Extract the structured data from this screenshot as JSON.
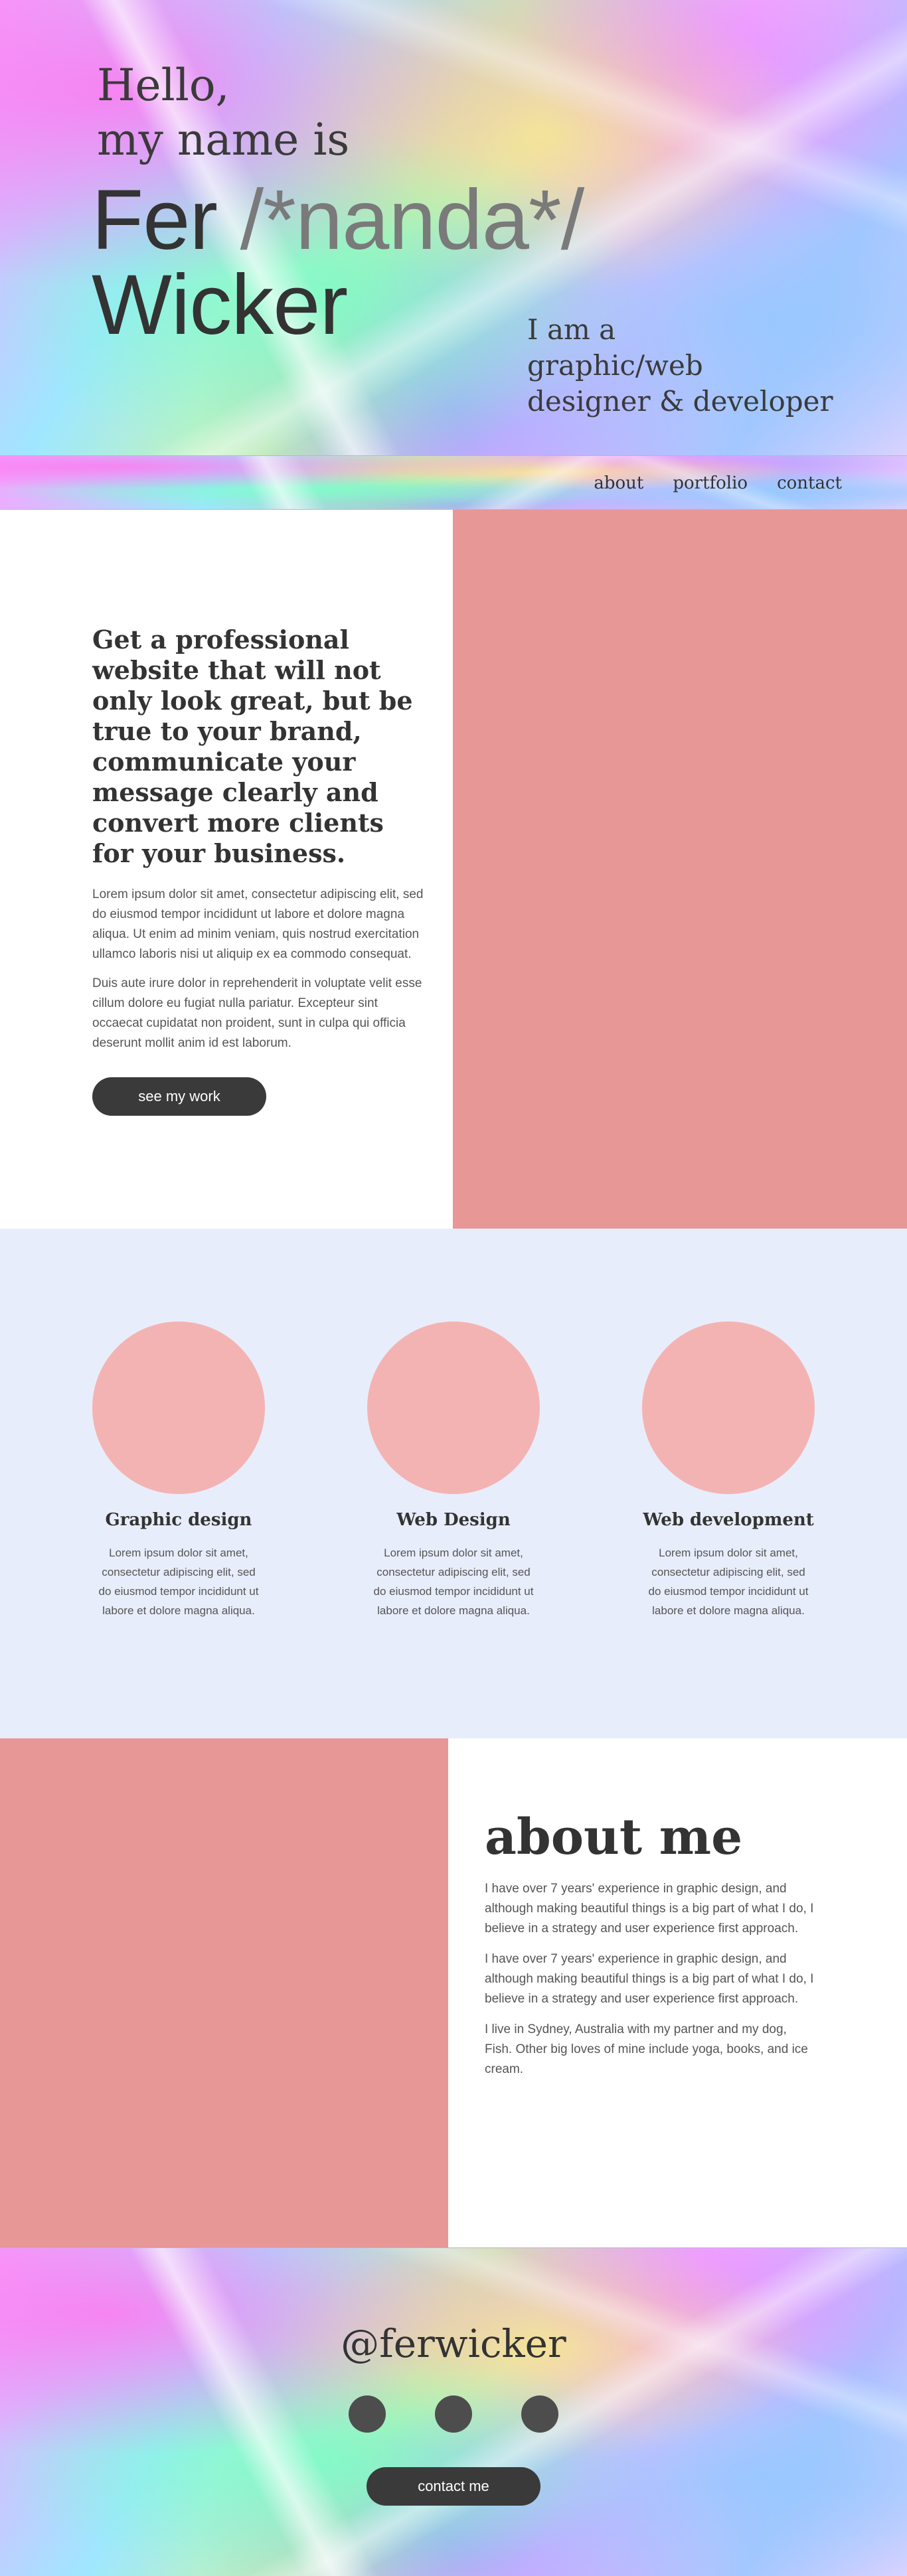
{
  "hero": {
    "greeting_line1": "Hello,",
    "greeting_line2": "my name is",
    "name_first": "Fer",
    "name_comment": "/*nanda*/",
    "name_last": "Wicker",
    "tagline_line1": "I am a",
    "tagline_line2": "graphic/web",
    "tagline_line3": "designer & developer"
  },
  "nav": {
    "items": [
      {
        "label": "about"
      },
      {
        "label": "portfolio"
      },
      {
        "label": "contact"
      }
    ]
  },
  "intro": {
    "headline": "Get a professional website that will not only look great, but be true to your brand, communicate your message clearly and convert more clients for your business.",
    "paragraphs": [
      "Lorem ipsum dolor sit amet, consectetur adipiscing elit, sed do eiusmod tempor incididunt ut labore et dolore magna aliqua. Ut enim ad minim veniam, quis nostrud exercitation ullamco laboris nisi ut aliquip ex ea commodo consequat.",
      "Duis aute irure dolor in reprehenderit in voluptate velit esse cillum dolore eu fugiat nulla pariatur. Excepteur sint occaecat cupidatat non proident, sunt in culpa qui officia deserunt mollit anim id est laborum."
    ],
    "cta_label": "see my work",
    "accent_color": "#e89797"
  },
  "services": {
    "background": "#e8edfb",
    "circle_color": "#f4b3b3",
    "items": [
      {
        "title": "Graphic design",
        "description": "Lorem ipsum dolor sit amet, consectetur adipiscing elit, sed do eiusmod tempor incididunt ut labore et dolore magna aliqua."
      },
      {
        "title": "Web Design",
        "description": "Lorem ipsum dolor sit amet, consectetur adipiscing elit, sed do eiusmod tempor incididunt ut labore et dolore magna aliqua."
      },
      {
        "title": "Web development",
        "description": "Lorem ipsum dolor sit amet, consectetur adipiscing elit, sed do eiusmod tempor incididunt ut labore et dolore magna aliqua."
      }
    ]
  },
  "about": {
    "title": "about me",
    "paragraphs": [
      "I have over 7 years' experience in graphic design, and although making beautiful things is a big part of what I do, I believe in a strategy and user experience first approach.",
      "I have over 7 years' experience in graphic design, and although making beautiful things is a big part of what I do, I believe in a strategy and user experience first approach.",
      "I live in Sydney, Australia with my partner and my dog, Fish. Other big loves of mine include yoga, books, and ice cream."
    ]
  },
  "footer": {
    "handle": "@ferwicker",
    "social_icons": [
      "social-icon-1",
      "social-icon-2",
      "social-icon-3"
    ],
    "cta_label": "contact me"
  },
  "colors": {
    "text_dark": "#333333",
    "button_dark": "#3a3a3a"
  }
}
